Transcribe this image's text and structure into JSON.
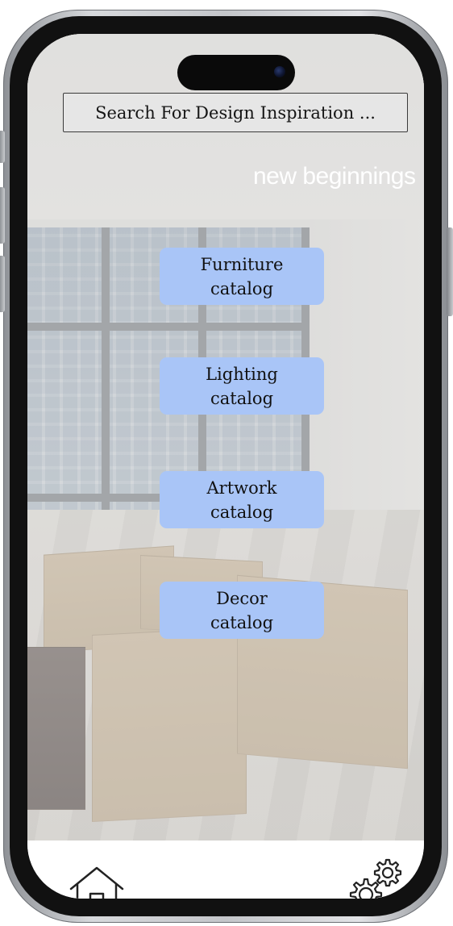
{
  "search": {
    "text": "Search For Design Inspiration ..."
  },
  "hero": {
    "caption": "new beginnings"
  },
  "catalogs": [
    {
      "line1": "Furniture",
      "line2": "catalog"
    },
    {
      "line1": "Lighting",
      "line2": "catalog"
    },
    {
      "line1": "Artwork",
      "line2": "catalog"
    },
    {
      "line1": "Decor",
      "line2": "catalog"
    }
  ],
  "nav": {
    "home_icon": "home-icon",
    "settings_icon": "gears-icon"
  },
  "colors": {
    "button_bg": "#a9c5f7",
    "caption_text": "#ffffff",
    "frame": "#111111"
  }
}
